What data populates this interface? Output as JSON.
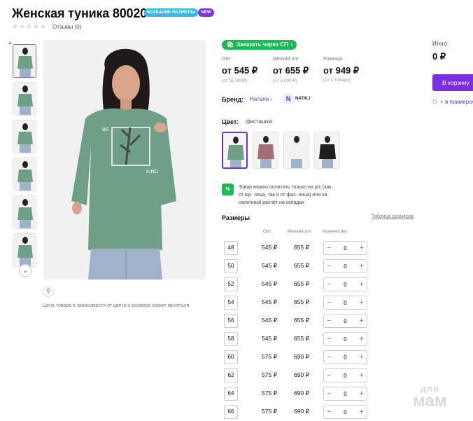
{
  "product": {
    "title": "Женская туника 80020",
    "badges": [
      "БОЛЬШИЕ РАЗМЕРЫ",
      "NEW"
    ],
    "reviews": "Отзывы (0)",
    "rating_stars": 0
  },
  "gallery": {
    "thumb_count": 6,
    "active_thumb": 0,
    "price_note": "Цена товара в зависимости от цвета и размера может меняться"
  },
  "sp_button": "Заказать через СП",
  "prices": [
    {
      "label": "Опт",
      "value": "от 545 ₽",
      "sub": "(от 35 000₽)"
    },
    {
      "label": "Мелкий опт",
      "value": "от 655 ₽",
      "sub": "(от 5 000 ₽)"
    },
    {
      "label": "Розница",
      "value": "от 949 ₽",
      "sub": "(от 1 товара)"
    }
  ],
  "brand": {
    "label": "Бренд:",
    "name": "Натали",
    "logo_mark": "N",
    "logo_text": "NATALI"
  },
  "color": {
    "label": "Цвет:",
    "value": "фисташка",
    "swatches": [
      "#6f9f86",
      "#a56e74",
      "#f2f2f2",
      "#1f1f1f"
    ]
  },
  "payment_note": {
    "icon": "%",
    "text": "Товар можно оплатить только на р/с (как от юр. лица, так и от физ. лица) или за наличный расчёт на складах"
  },
  "sizes": {
    "title": "Размеры",
    "table_link": "Таблица размеров",
    "headers": {
      "opt": "Опт",
      "small": "Мелкий опт",
      "qty": "Количество"
    },
    "rows": [
      {
        "size": "48",
        "opt": "545 ₽",
        "small": "655 ₽",
        "qty": "0"
      },
      {
        "size": "50",
        "opt": "545 ₽",
        "small": "655 ₽",
        "qty": "0"
      },
      {
        "size": "52",
        "opt": "545 ₽",
        "small": "655 ₽",
        "qty": "0"
      },
      {
        "size": "54",
        "opt": "545 ₽",
        "small": "655 ₽",
        "qty": "0"
      },
      {
        "size": "56",
        "opt": "545 ₽",
        "small": "655 ₽",
        "qty": "0"
      },
      {
        "size": "58",
        "opt": "545 ₽",
        "small": "655 ₽",
        "qty": "0"
      },
      {
        "size": "60",
        "opt": "575 ₽",
        "small": "690 ₽",
        "qty": "0"
      },
      {
        "size": "62",
        "opt": "575 ₽",
        "small": "690 ₽",
        "qty": "0"
      },
      {
        "size": "64",
        "opt": "575 ₽",
        "small": "690 ₽",
        "qty": "0"
      },
      {
        "size": "66",
        "opt": "575 ₽",
        "small": "690 ₽",
        "qty": "0"
      }
    ]
  },
  "summary": {
    "total_label": "Итого:",
    "total_value": "0 ₽",
    "cart_button": "В корзину",
    "fitting_link": "+ в примерочную"
  },
  "watermark": {
    "line1": "для",
    "line2": "мам"
  },
  "colors": {
    "accent": "#7b2fe0",
    "green": "#1db954",
    "badge_blue": "#36b9e6",
    "tunic": "#6f9f86"
  }
}
